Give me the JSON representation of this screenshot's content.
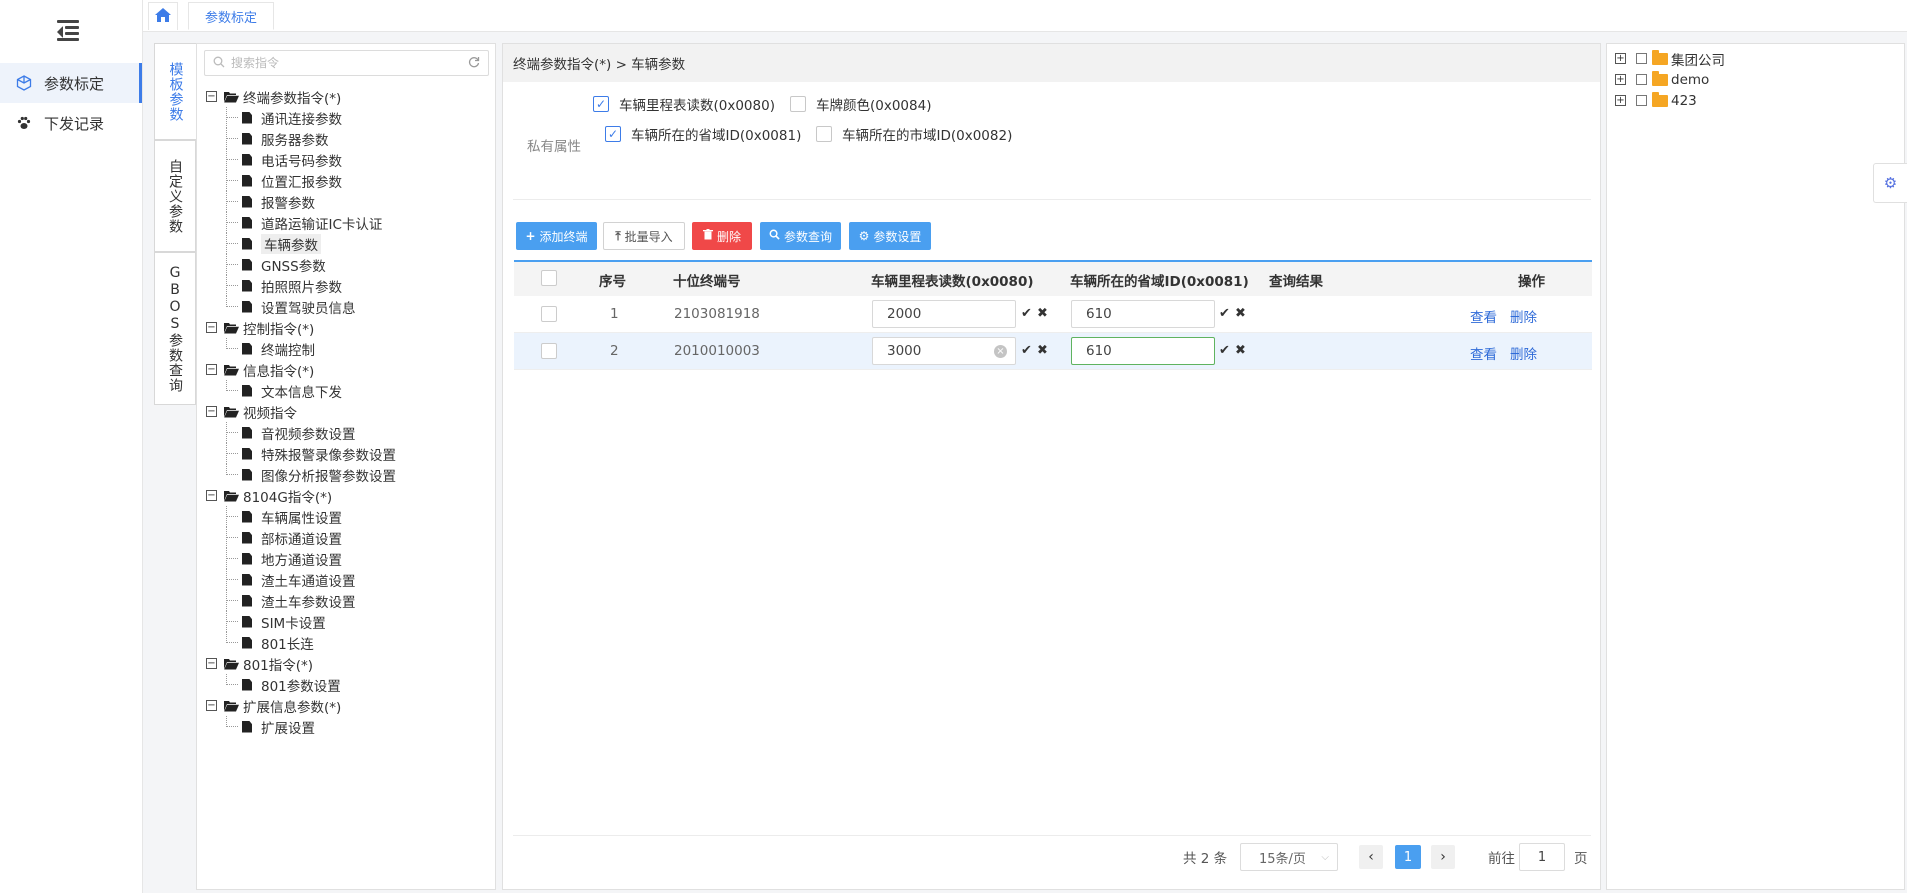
{
  "nav": {
    "items": [
      {
        "label": "参数标定",
        "icon": "cube-icon",
        "active": true
      },
      {
        "label": "下发记录",
        "icon": "paw-icon",
        "active": false
      }
    ]
  },
  "tabs": {
    "home_icon": "home-icon",
    "current": "参数标定"
  },
  "vtabs": [
    {
      "label": "模板参数",
      "active": true
    },
    {
      "label": "自定义参数",
      "active": false
    },
    {
      "label": "GBOS参数查询",
      "active": false
    }
  ],
  "tree": {
    "search_placeholder": "搜索指令",
    "nodes": [
      {
        "label": "终端参数指令(*)",
        "type": "parent"
      },
      {
        "label": "通讯连接参数",
        "type": "child"
      },
      {
        "label": "服务器参数",
        "type": "child"
      },
      {
        "label": "电话号码参数",
        "type": "child"
      },
      {
        "label": "位置汇报参数",
        "type": "child"
      },
      {
        "label": "报警参数",
        "type": "child"
      },
      {
        "label": "道路运输证IC卡认证",
        "type": "child"
      },
      {
        "label": "车辆参数",
        "type": "child",
        "selected": true
      },
      {
        "label": "GNSS参数",
        "type": "child"
      },
      {
        "label": "拍照照片参数",
        "type": "child"
      },
      {
        "label": "设置驾驶员信息",
        "type": "child",
        "last": true
      },
      {
        "label": "控制指令(*)",
        "type": "parent"
      },
      {
        "label": "终端控制",
        "type": "child",
        "last": true
      },
      {
        "label": "信息指令(*)",
        "type": "parent"
      },
      {
        "label": "文本信息下发",
        "type": "child",
        "last": true
      },
      {
        "label": "视频指令",
        "type": "parent"
      },
      {
        "label": "音视频参数设置",
        "type": "child"
      },
      {
        "label": "特殊报警录像参数设置",
        "type": "child"
      },
      {
        "label": "图像分析报警参数设置",
        "type": "child",
        "last": true
      },
      {
        "label": "8104G指令(*)",
        "type": "parent"
      },
      {
        "label": "车辆属性设置",
        "type": "child"
      },
      {
        "label": "部标通道设置",
        "type": "child"
      },
      {
        "label": "地方通道设置",
        "type": "child"
      },
      {
        "label": "渣土车通道设置",
        "type": "child"
      },
      {
        "label": "渣土车参数设置",
        "type": "child"
      },
      {
        "label": "SIM卡设置",
        "type": "child"
      },
      {
        "label": "801长连",
        "type": "child",
        "last": true
      },
      {
        "label": "801指令(*)",
        "type": "parent"
      },
      {
        "label": "801参数设置",
        "type": "child",
        "last": true
      },
      {
        "label": "扩展信息参数(*)",
        "type": "parent"
      },
      {
        "label": "扩展设置",
        "type": "child",
        "last": true
      }
    ]
  },
  "main": {
    "breadcrumb": "终端参数指令(*) > 车辆参数",
    "private_label": "私有属性",
    "private_options": [
      {
        "label": "车辆里程表读数(0x0080)",
        "checked": true
      },
      {
        "label": "车牌颜色(0x0084)",
        "checked": false
      },
      {
        "label": "车辆所在的省域ID(0x0081)",
        "checked": true
      },
      {
        "label": "车辆所在的市域ID(0x0082)",
        "checked": false
      }
    ],
    "toolbar": {
      "add": "添加终端",
      "import": "批量导入",
      "delete": "删除",
      "query": "参数查询",
      "settings": "参数设置"
    },
    "table": {
      "headers": [
        "序号",
        "十位终端号",
        "车辆里程表读数(0x0080)",
        "车辆所在的省域ID(0x0081)",
        "查询结果",
        "操作"
      ],
      "rows": [
        {
          "index": "1",
          "terminal": "2103081918",
          "mileage": "2000",
          "province": "610",
          "result": "",
          "view": "查看",
          "delete": "删除"
        },
        {
          "index": "2",
          "terminal": "2010010003",
          "mileage": "3000",
          "province": "610",
          "result": "",
          "view": "查看",
          "delete": "删除"
        }
      ]
    },
    "pager": {
      "total": "共 2 条",
      "page_size": "15条/页",
      "current_page": "1",
      "goto_label": "前往",
      "goto_value": "1",
      "page_suffix": "页"
    }
  },
  "org_tree": [
    {
      "label": "集团公司"
    },
    {
      "label": "demo"
    },
    {
      "label": "423"
    }
  ],
  "colors": {
    "accent": "#4a9ff0",
    "danger": "#f04848",
    "link": "#2f6bd8",
    "folder": "#f5a623"
  }
}
